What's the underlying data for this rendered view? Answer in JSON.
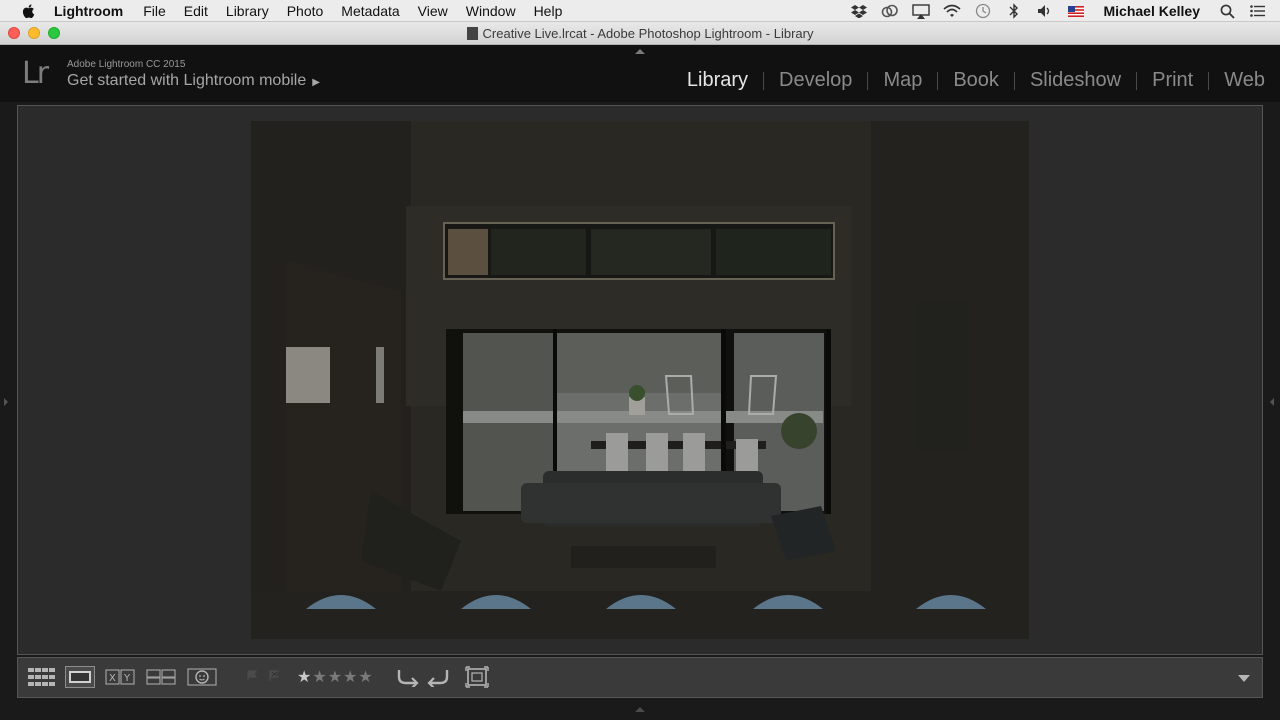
{
  "menubar": {
    "app_name": "Lightroom",
    "items": [
      "File",
      "Edit",
      "Library",
      "Photo",
      "Metadata",
      "View",
      "Window",
      "Help"
    ],
    "user": "Michael Kelley"
  },
  "window": {
    "title": "Creative Live.lrcat - Adobe Photoshop Lightroom - Library"
  },
  "identity_plate": {
    "logo": "Lr",
    "product": "Adobe Lightroom CC 2015",
    "promo": "Get started with Lightroom mobile",
    "promo_arrow": "▶"
  },
  "modules": {
    "active": "Library",
    "items": [
      "Library",
      "Develop",
      "Map",
      "Book",
      "Slideshow",
      "Print",
      "Web"
    ]
  },
  "toolbar": {
    "view_buttons": [
      "grid-view-icon",
      "loupe-view-icon",
      "compare-view-icon",
      "survey-view-icon",
      "people-view-icon"
    ],
    "compare_label": "X|Y",
    "rating": 1,
    "rating_max": 5,
    "stars_text": "★★★★★"
  },
  "colors": {
    "menubar_bg": "#ececec",
    "lr_bg": "#111111",
    "loupe_bg": "#2b2b2b",
    "toolbar_bg": "#3a3a3a",
    "active_module": "#e6e6e6",
    "inactive_module": "#8a8a8a"
  }
}
